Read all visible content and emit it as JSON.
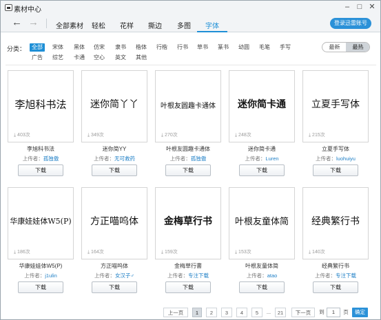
{
  "window": {
    "title": "素材中心"
  },
  "nav": {
    "back_icon": "arrow-left-icon",
    "forward_icon": "arrow-right-icon",
    "tabs": [
      "全部素材",
      "轻松",
      "花样",
      "撕边",
      "多图",
      "字体"
    ],
    "active_tab": "字体",
    "login_label": "登录迅雷账号"
  },
  "filters": {
    "label": "分类：",
    "row1": [
      "全部",
      "宋体",
      "黑体",
      "仿宋",
      "隶书",
      "楷体",
      "行楷",
      "行书",
      "草书",
      "篆书",
      "幼圆",
      "毛笔",
      "手写"
    ],
    "row2": [
      "广告",
      "综艺",
      "卡通",
      "空心",
      "英文",
      "其他"
    ],
    "active": "全部",
    "sort": {
      "newest": "最新",
      "hottest": "最热",
      "active": "最热"
    }
  },
  "fonts": [
    {
      "preview": "李旭科书法",
      "downloads": "403次",
      "name": "李旭科书法",
      "uploader_label": "上传者：",
      "uploader": "孤独傲",
      "download_label": "下载"
    },
    {
      "preview": "迷你简丫丫",
      "downloads": "349次",
      "name": "迷你简YY",
      "uploader_label": "上传者：",
      "uploader": "无可救药",
      "download_label": "下载"
    },
    {
      "preview": "叶根友圆趣卡通体",
      "downloads": "270次",
      "name": "叶根友圆趣卡通体",
      "uploader_label": "上传者：",
      "uploader": "孤独傲",
      "download_label": "下载"
    },
    {
      "preview": "迷你简卡通",
      "downloads": "248次",
      "name": "迷你简卡通",
      "uploader_label": "上传者：",
      "uploader": "Luren",
      "download_label": "下载"
    },
    {
      "preview": "立夏手写体",
      "downloads": "215次",
      "name": "立夏手写体",
      "uploader_label": "上传者：",
      "uploader": "luohuiyu",
      "download_label": "下载"
    },
    {
      "preview": "华康娃娃体W5(P)",
      "downloads": "186次",
      "name": "华康娃娃体W5(P)",
      "uploader_label": "上传者：",
      "uploader": "j1ulin",
      "download_label": "下载"
    },
    {
      "preview": "方正喵呜体",
      "downloads": "164次",
      "name": "方正喵呜体",
      "uploader_label": "上传者：",
      "uploader": "女汉子♂",
      "download_label": "下载"
    },
    {
      "preview": "金梅草行书",
      "downloads": "159次",
      "name": "金梅草行書",
      "uploader_label": "上传者：",
      "uploader": "专注下载",
      "download_label": "下载"
    },
    {
      "preview": "叶根友童体简",
      "downloads": "153次",
      "name": "叶根友童体简",
      "uploader_label": "上传者：",
      "uploader": "atao",
      "download_label": "下载"
    },
    {
      "preview": "经典繁行书",
      "downloads": "140次",
      "name": "经典繁行书",
      "uploader_label": "上传者：",
      "uploader": "专注下载",
      "download_label": "下载"
    }
  ],
  "pagination": {
    "prev": "上一页",
    "pages": [
      "1",
      "2",
      "3",
      "4",
      "5",
      "...",
      "21"
    ],
    "current": "1",
    "next": "下一页",
    "goto_label": "到",
    "goto_value": "1",
    "page_unit": "页",
    "confirm": "确定"
  }
}
